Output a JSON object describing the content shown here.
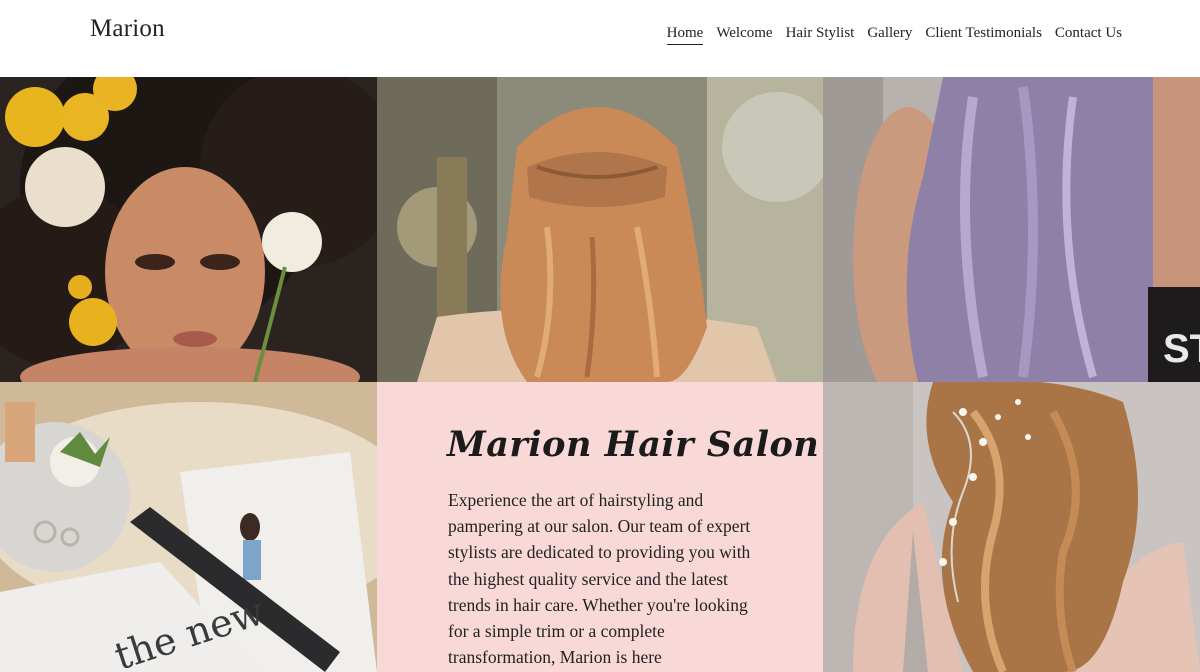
{
  "header": {
    "logo": "Marion",
    "nav": [
      {
        "label": "Home",
        "active": true
      },
      {
        "label": "Welcome",
        "active": false
      },
      {
        "label": "Hair Stylist",
        "active": false
      },
      {
        "label": "Gallery",
        "active": false
      },
      {
        "label": "Client Testimonials",
        "active": false
      },
      {
        "label": "Contact Us",
        "active": false
      }
    ]
  },
  "hero": {
    "title": "Marion Hair Salon",
    "body": "Experience the art of hairstyling and pampering at our salon. Our team of expert stylists are dedicated to providing you with the highest quality service and the latest trends in hair care. Whether you're looking for a simple trim or a complete transformation, Marion is here",
    "background": "#f9d8d8"
  },
  "magazine": {
    "cover_text": "the new"
  }
}
